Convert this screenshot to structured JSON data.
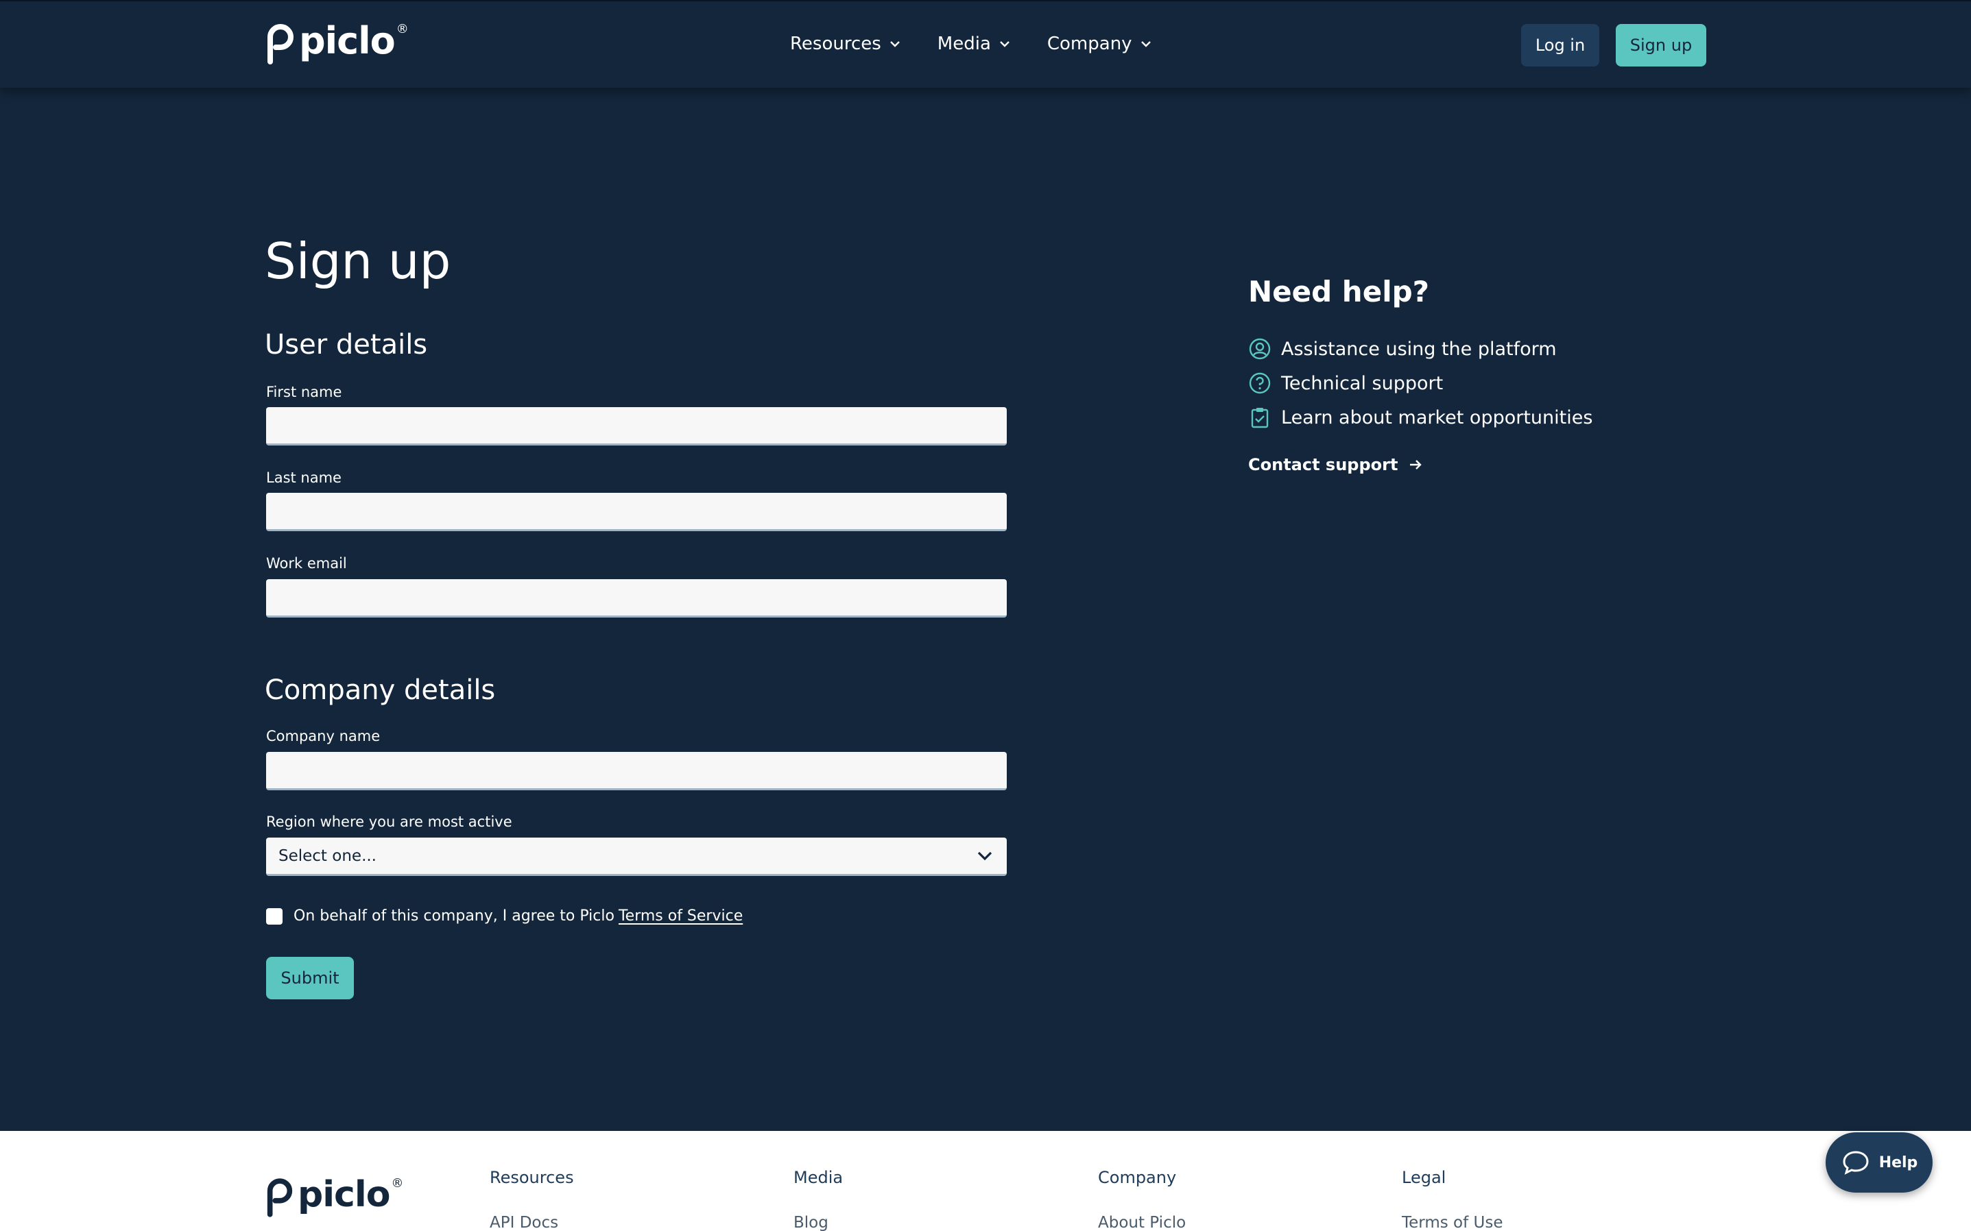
{
  "header": {
    "logo_text": "piclo",
    "logo_mark": "®",
    "nav": [
      {
        "label": "Resources"
      },
      {
        "label": "Media"
      },
      {
        "label": "Company"
      }
    ],
    "login_label": "Log in",
    "signup_label": "Sign up"
  },
  "form": {
    "title": "Sign up",
    "user_section_title": "User details",
    "fields": {
      "first_name": {
        "label": "First name",
        "value": ""
      },
      "last_name": {
        "label": "Last name",
        "value": ""
      },
      "work_email": {
        "label": "Work email",
        "value": ""
      },
      "company_name": {
        "label": "Company name",
        "value": ""
      }
    },
    "company_section_title": "Company details",
    "region": {
      "label": "Region where you are most active",
      "selected": "Select one..."
    },
    "agree_text": "On behalf of this company, I agree to Piclo",
    "tos_link": "Terms of Service",
    "submit_label": "Submit"
  },
  "help": {
    "title": "Need help?",
    "items": [
      {
        "icon": "user-circle-icon",
        "label": "Assistance using the platform"
      },
      {
        "icon": "question-circle-icon",
        "label": "Technical support"
      },
      {
        "icon": "clipboard-check-icon",
        "label": "Learn about market opportunities"
      }
    ],
    "contact_label": "Contact support"
  },
  "footer": {
    "logo_text": "piclo",
    "logo_mark": "®",
    "columns": [
      {
        "title": "Resources",
        "first_link": "API Docs"
      },
      {
        "title": "Media",
        "first_link": "Blog"
      },
      {
        "title": "Company",
        "first_link": "About Piclo"
      },
      {
        "title": "Legal",
        "first_link": "Terms of Use"
      }
    ]
  },
  "help_widget": {
    "label": "Help"
  },
  "colors": {
    "background": "#13263b",
    "accent": "#5bc6c0",
    "secondary_button": "#1f3c5b",
    "input_background": "#f7f7f7",
    "footer_background": "#ffffff"
  }
}
